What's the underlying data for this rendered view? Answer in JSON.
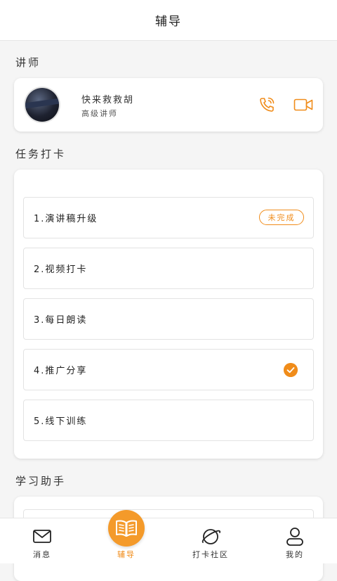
{
  "header": {
    "title": "辅导"
  },
  "teacher_section": {
    "title": "讲师"
  },
  "teacher": {
    "name": "快来救救胡",
    "role": "高级讲师"
  },
  "tasks_section": {
    "title": "任务打卡"
  },
  "tasks": [
    {
      "label": "1.演讲稿升级",
      "status": "未完成"
    },
    {
      "label": "2.视频打卡"
    },
    {
      "label": "3.每日朗读"
    },
    {
      "label": "4.推广分享",
      "completed": true
    },
    {
      "label": "5.线下训练"
    }
  ],
  "study_section": {
    "title": "学习助手"
  },
  "tabbar": {
    "items": [
      {
        "label": "消息",
        "icon": "message-icon"
      },
      {
        "label": "辅导",
        "icon": "book-icon",
        "active": true
      },
      {
        "label": "打卡社区",
        "icon": "planet-icon"
      },
      {
        "label": "我的",
        "icon": "user-icon"
      }
    ]
  },
  "colors": {
    "accent": "#f08c1a",
    "background": "#f5f5f5"
  }
}
